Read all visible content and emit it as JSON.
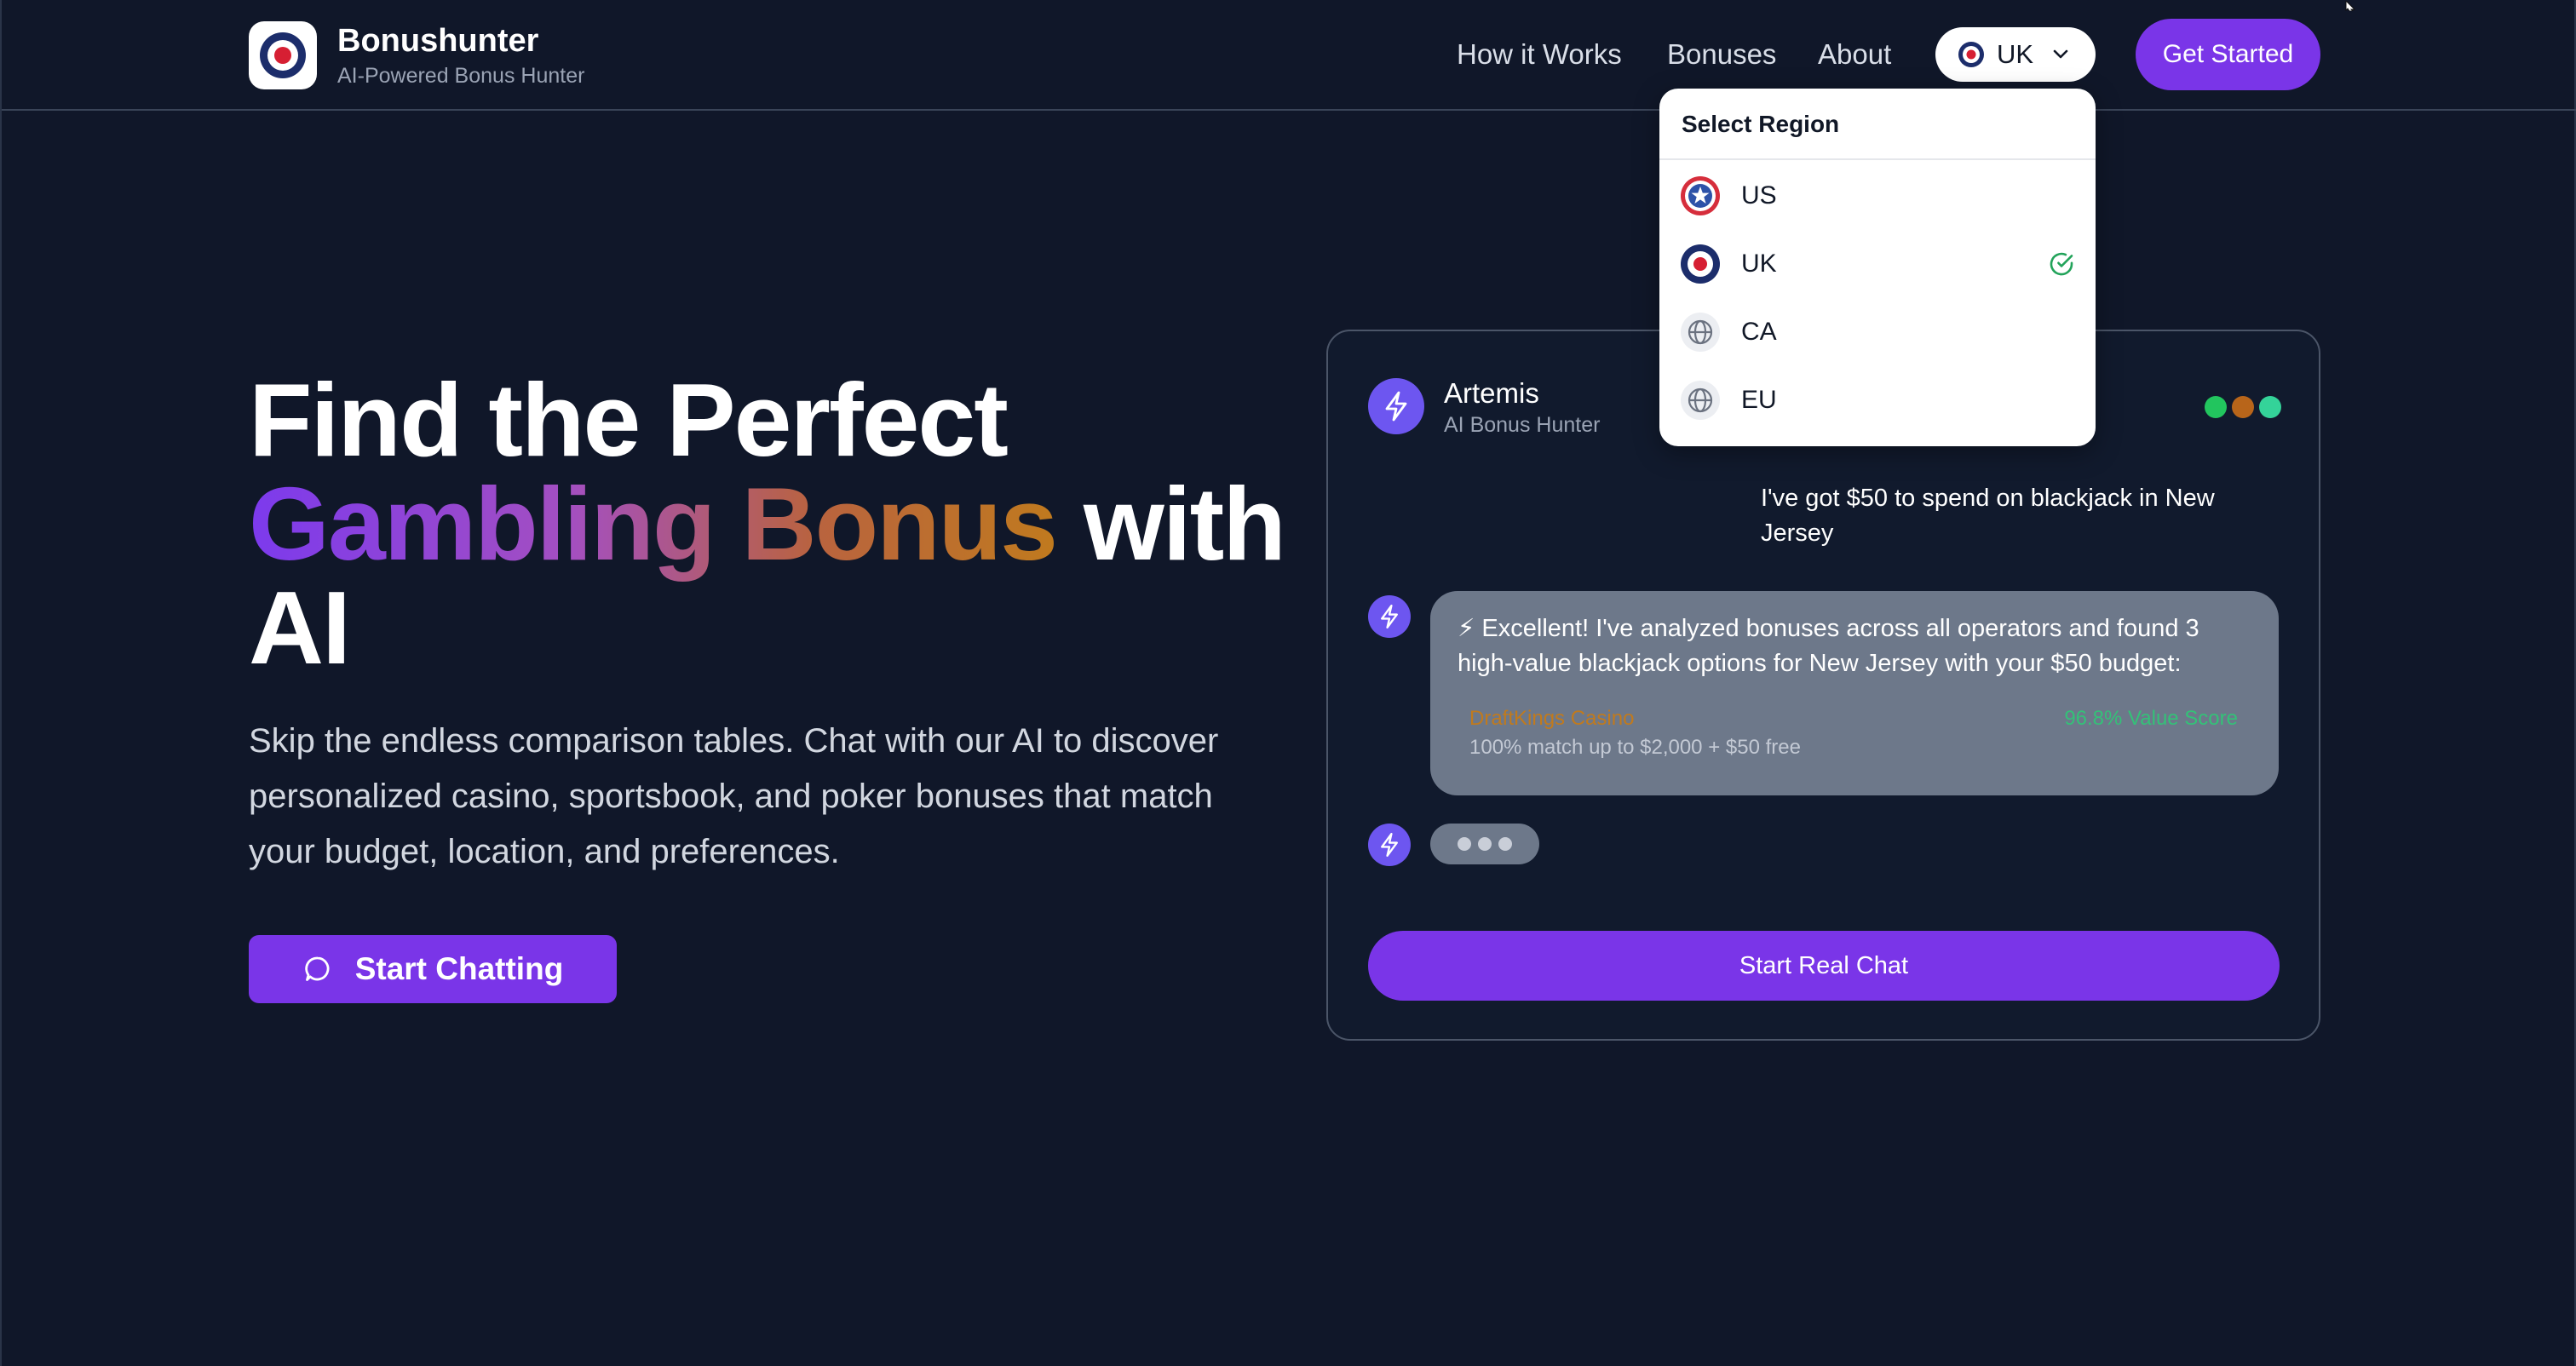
{
  "brand": {
    "name": "Bonushunter",
    "tagline": "AI-Powered Bonus Hunter"
  },
  "nav": [
    {
      "label": "How it Works"
    },
    {
      "label": "Bonuses"
    },
    {
      "label": "About"
    }
  ],
  "region": {
    "current": "UK",
    "title": "Select Region",
    "options": [
      {
        "label": "US",
        "icon": "us-flag-icon"
      },
      {
        "label": "UK",
        "icon": "uk-roundel-icon",
        "selected": true
      },
      {
        "label": "CA",
        "icon": "globe-icon"
      },
      {
        "label": "EU",
        "icon": "globe-icon"
      }
    ]
  },
  "cta": {
    "label": "Get Started"
  },
  "hero": {
    "line1": "Find the Perfect",
    "highlight": "Gambling Bonus",
    "line2_tail": " with",
    "line3": "AI",
    "lead": "Skip the endless comparison tables. Chat with our AI to discover personalized casino, sportsbook, and poker bonuses that match your budget, location, and preferences.",
    "button": "Start Chatting"
  },
  "chat": {
    "agent_name": "Artemis",
    "agent_role": "AI Bonus Hunter",
    "status_colors": [
      "#22c55e",
      "#b8651a",
      "#34d399"
    ],
    "user_message": "I've got $50 to spend on blackjack in New Jersey",
    "bot_message": "⚡ Excellent! I've analyzed bonuses across all operators and found 3 high-value blackjack options for New Jersey with your $50 budget:",
    "offer": {
      "name": "DraftKings Casino",
      "description": "100% match up to $2,000 + $50 free",
      "score": "96.8% Value Score"
    },
    "button": "Start Real Chat"
  },
  "colors": {
    "background": "#101729",
    "accent": "#7a35e8",
    "bubble": "#6d788a",
    "score_green": "#34c178",
    "offer_orange": "#c07a1e"
  }
}
